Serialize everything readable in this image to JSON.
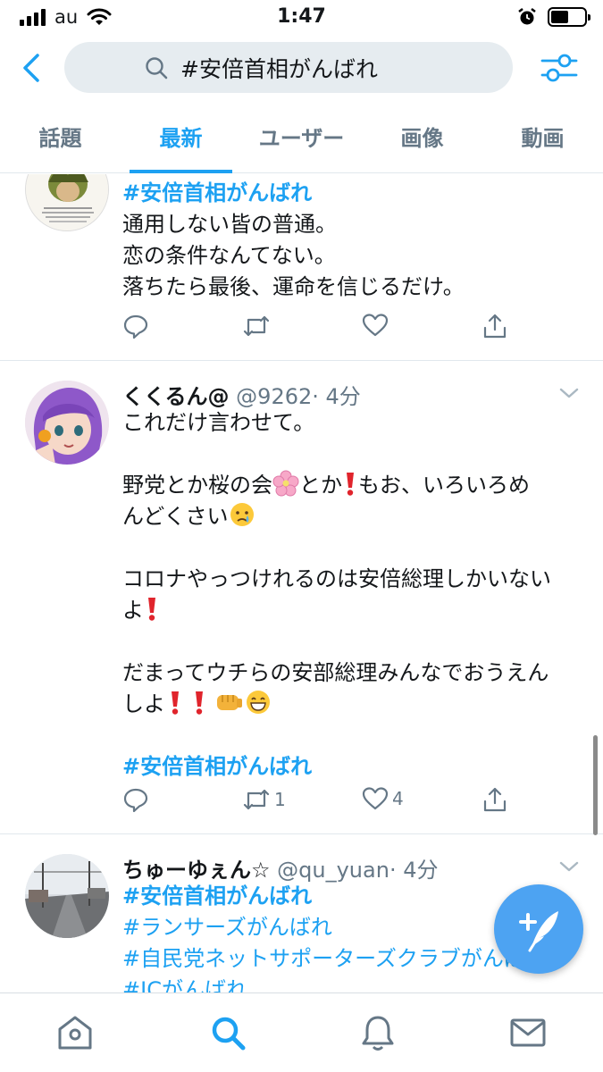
{
  "status_bar": {
    "carrier": "au",
    "time": "1:47"
  },
  "search": {
    "query": "#安倍首相がんばれ"
  },
  "tabs": [
    {
      "label": "話題",
      "active": false
    },
    {
      "label": "最新",
      "active": true
    },
    {
      "label": "ユーザー",
      "active": false
    },
    {
      "label": "画像",
      "active": false
    },
    {
      "label": "動画",
      "active": false
    }
  ],
  "tweets": [
    {
      "hashtag": "#安倍首相がんばれ",
      "lines": [
        "通用しない皆の普通。",
        "恋の条件なんてない。",
        "落ちたら最後、運命を信じるだけ。"
      ],
      "actions": {
        "reply": "",
        "retweet": "",
        "like": "",
        "share": ""
      }
    },
    {
      "name": "くくるん@",
      "handle": "@9262",
      "time": "· 4分",
      "line1": "これだけ言わせて。",
      "line2a": "野党とか桜の会",
      "line2b": "とか",
      "line2c": "もお、いろいろめ",
      "line3": "んどくさい",
      "line4": "コロナやっつけれるのは安倍総理しかいない",
      "line5": "よ",
      "line6": "だまってウチらの安部総理みんなでおうえん",
      "line7": "しよ",
      "hashtag": "#安倍首相がんばれ",
      "actions": {
        "reply": "",
        "retweet": "1",
        "like": "4",
        "share": ""
      }
    },
    {
      "name": "ちゅーゆぇん☆",
      "handle": "@qu_yuan",
      "time": "· 4分",
      "hashtags": [
        "#安倍首相がんばれ",
        "#ランサーズがんばれ",
        "#自民党ネットサポーターズクラブがんばれ",
        "#JCがんばれ"
      ]
    }
  ],
  "icons": {
    "back": "chevron-left-icon",
    "search": "search-icon",
    "filter": "filter-sliders-icon",
    "reply": "reply-icon",
    "retweet": "retweet-icon",
    "like": "heart-icon",
    "share": "share-icon",
    "compose": "compose-tweet-icon",
    "home": "home-icon",
    "explore": "search-icon",
    "notifications": "bell-icon",
    "messages": "mail-icon"
  },
  "colors": {
    "accent": "#1da1f2",
    "muted": "#657786",
    "text": "#14171a",
    "fab": "#4da3f2"
  }
}
